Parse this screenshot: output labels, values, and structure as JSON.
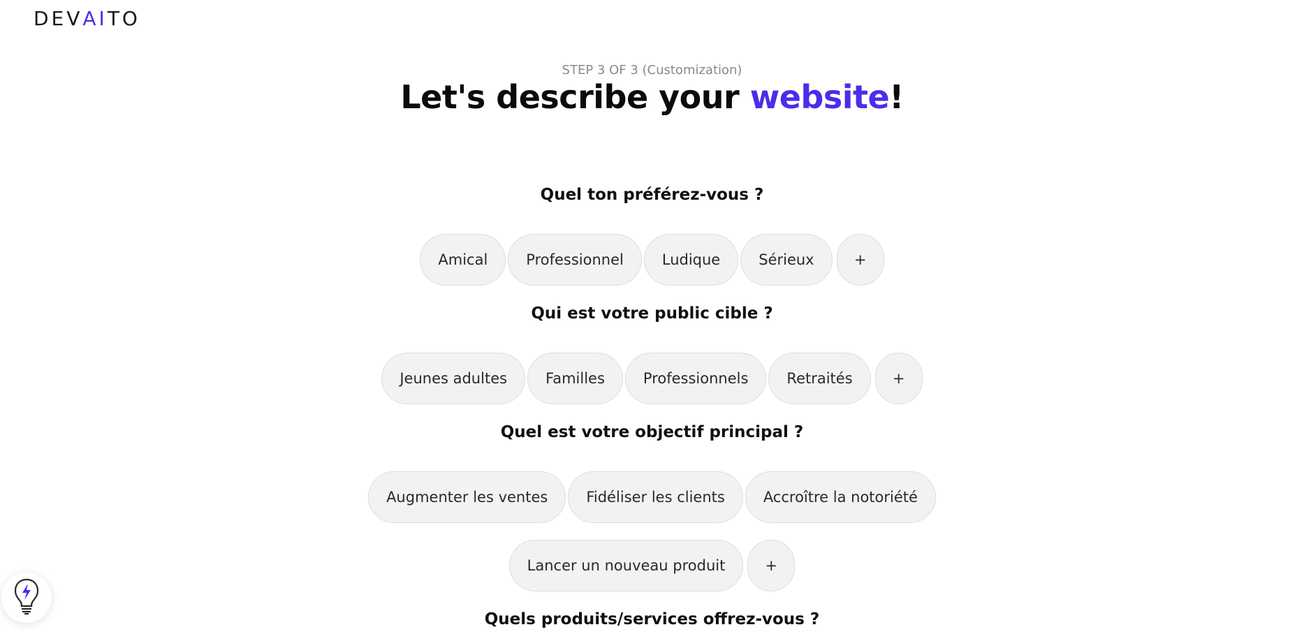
{
  "logo": {
    "part1": "DEV",
    "part2": "AI",
    "part3": "TO"
  },
  "step": "STEP 3 OF 3 (Customization)",
  "title": {
    "prefix": "Let's describe your ",
    "highlight": "website",
    "suffix": "!"
  },
  "questions": [
    {
      "label": "Quel ton préférez-vous ?",
      "options": [
        "Amical",
        "Professionnel",
        "Ludique",
        "Sérieux"
      ],
      "add": "+"
    },
    {
      "label": "Qui est votre public cible ?",
      "options": [
        "Jeunes adultes",
        "Familles",
        "Professionnels",
        "Retraités"
      ],
      "add": "+"
    },
    {
      "label": "Quel est votre objectif principal ?",
      "options": [
        "Augmenter les ventes",
        "Fidéliser les clients",
        "Accroître la notoriété",
        "Lancer un nouveau produit"
      ],
      "add": "+"
    },
    {
      "label": "Quels produits/services offrez-vous ?"
    }
  ],
  "colors": {
    "accent": "#4a2ee8",
    "chip_bg": "#f2f2f2",
    "chip_border": "#dddddd",
    "muted": "#8a8a8a"
  },
  "icons": {
    "helper": "lightbulb-bolt-icon"
  }
}
